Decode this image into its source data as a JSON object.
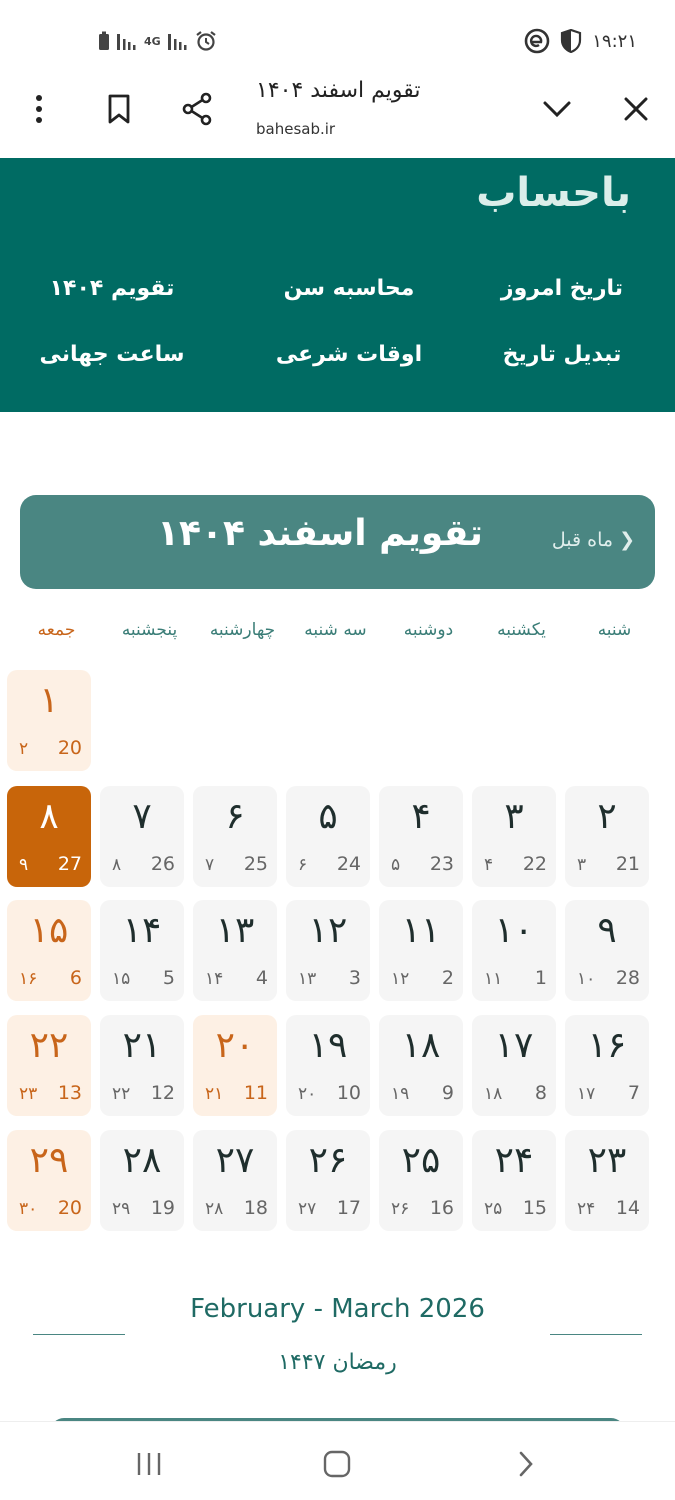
{
  "status_bar": {
    "time": "۱۹:۲۱",
    "network_type": "4G",
    "icons": [
      "battery-icon",
      "signal-icon",
      "alarm-icon",
      "app-notification-icon",
      "shield-icon"
    ]
  },
  "browser": {
    "page_title": "تقویم اسفند ۱۴۰۴",
    "url": "bahesab.ir",
    "icons": [
      "more-vert-icon",
      "bookmark-icon",
      "share-icon",
      "chevron-down-icon",
      "close-icon"
    ]
  },
  "site": {
    "logo": "باحساب",
    "nav": {
      "today_date": "تاریخ امروز",
      "age_calc": "محاسبه سن",
      "calendar_1404": "تقویم ۱۴۰۴",
      "date_convert": "تبدیل تاریخ",
      "prayer_times": "اوقات شرعی",
      "world_clock": "ساعت جهانی"
    }
  },
  "calendar": {
    "title": "تقویم اسفند ۱۴۰۴",
    "prev_month": "❮ ماه قبل",
    "weekdays": [
      "شنبه",
      "یکشنبه",
      "دوشنبه",
      "سه شنبه",
      "چهارشنبه",
      "پنجشنبه",
      "جمعه"
    ],
    "rows": [
      [
        null,
        null,
        null,
        null,
        null,
        null,
        {
          "p": "۱",
          "g": "20",
          "h": "۲",
          "type": "holiday"
        }
      ],
      [
        {
          "p": "۲",
          "g": "21",
          "h": "۳",
          "type": "normal"
        },
        {
          "p": "۳",
          "g": "22",
          "h": "۴",
          "type": "normal"
        },
        {
          "p": "۴",
          "g": "23",
          "h": "۵",
          "type": "normal"
        },
        {
          "p": "۵",
          "g": "24",
          "h": "۶",
          "type": "normal"
        },
        {
          "p": "۶",
          "g": "25",
          "h": "۷",
          "type": "normal"
        },
        {
          "p": "۷",
          "g": "26",
          "h": "۸",
          "type": "normal"
        },
        {
          "p": "۸",
          "g": "27",
          "h": "۹",
          "type": "today"
        }
      ],
      [
        {
          "p": "۹",
          "g": "28",
          "h": "۱۰",
          "type": "normal"
        },
        {
          "p": "۱۰",
          "g": "1",
          "h": "۱۱",
          "type": "normal"
        },
        {
          "p": "۱۱",
          "g": "2",
          "h": "۱۲",
          "type": "normal"
        },
        {
          "p": "۱۲",
          "g": "3",
          "h": "۱۳",
          "type": "normal"
        },
        {
          "p": "۱۳",
          "g": "4",
          "h": "۱۴",
          "type": "normal"
        },
        {
          "p": "۱۴",
          "g": "5",
          "h": "۱۵",
          "type": "normal"
        },
        {
          "p": "۱۵",
          "g": "6",
          "h": "۱۶",
          "type": "holiday"
        }
      ],
      [
        {
          "p": "۱۶",
          "g": "7",
          "h": "۱۷",
          "type": "normal"
        },
        {
          "p": "۱۷",
          "g": "8",
          "h": "۱۸",
          "type": "normal"
        },
        {
          "p": "۱۸",
          "g": "9",
          "h": "۱۹",
          "type": "normal"
        },
        {
          "p": "۱۹",
          "g": "10",
          "h": "۲۰",
          "type": "normal"
        },
        {
          "p": "۲۰",
          "g": "11",
          "h": "۲۱",
          "type": "holiday"
        },
        {
          "p": "۲۱",
          "g": "12",
          "h": "۲۲",
          "type": "normal"
        },
        {
          "p": "۲۲",
          "g": "13",
          "h": "۲۳",
          "type": "holiday"
        }
      ],
      [
        {
          "p": "۲۳",
          "g": "14",
          "h": "۲۴",
          "type": "normal"
        },
        {
          "p": "۲۴",
          "g": "15",
          "h": "۲۵",
          "type": "normal"
        },
        {
          "p": "۲۵",
          "g": "16",
          "h": "۲۶",
          "type": "normal"
        },
        {
          "p": "۲۶",
          "g": "17",
          "h": "۲۷",
          "type": "normal"
        },
        {
          "p": "۲۷",
          "g": "18",
          "h": "۲۸",
          "type": "normal"
        },
        {
          "p": "۲۸",
          "g": "19",
          "h": "۲۹",
          "type": "normal"
        },
        {
          "p": "۲۹",
          "g": "20",
          "h": "۳۰",
          "type": "holiday"
        }
      ]
    ],
    "gregorian_range": "February - March  2026",
    "hijri_range": "رمضان  ۱۴۴۷"
  },
  "colors": {
    "brand_green": "#006b63",
    "header_teal": "#4a8682",
    "today_orange": "#c8650a",
    "holiday_bg": "#fdf0e4"
  },
  "system_nav": {
    "icons": [
      "recent-apps-icon",
      "home-icon",
      "back-icon"
    ]
  }
}
